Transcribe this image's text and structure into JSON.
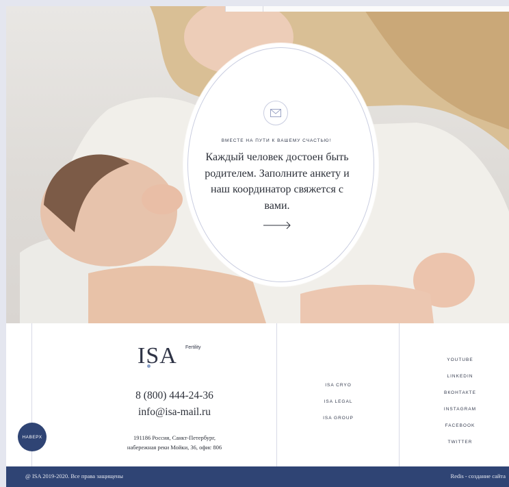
{
  "hero": {
    "kicker": "ВМЕСТЕ НА ПУТИ К ВАШЕМУ СЧАСТЬЮ!",
    "headline": "Каждый человек достоен быть родителем. Заполните анкету и наш координатор свяжется с вами.",
    "mail_icon": "envelope-icon",
    "arrow_icon": "arrow-right-icon"
  },
  "footer": {
    "logo": {
      "brand": "ISA",
      "tag": "Fertility"
    },
    "phone": "8 (800) 444-24-36",
    "email": "info@isa-mail.ru",
    "address_line1": "191186 Россия, Санкт-Петербург,",
    "address_line2": "набережная реки Мойки, 36, офис 806",
    "up_button": "НАВЕРХ",
    "links": [
      "ISA CRYO",
      "ISA LEGAL",
      "ISA GROUP"
    ],
    "social": [
      "YOUTUBE",
      "LINKEDIN",
      "ВКОНТАКТЕ",
      "INSTAGRAM",
      "FACEBOOK",
      "TWITTER"
    ]
  },
  "bottom_bar": {
    "copyright": "@ ISA 2019-2020. Все права защищены",
    "credit": "Redis - создание сайта"
  },
  "colors": {
    "accent": "#2f4474",
    "text": "#2b2f38",
    "line": "#d7d9e6"
  }
}
